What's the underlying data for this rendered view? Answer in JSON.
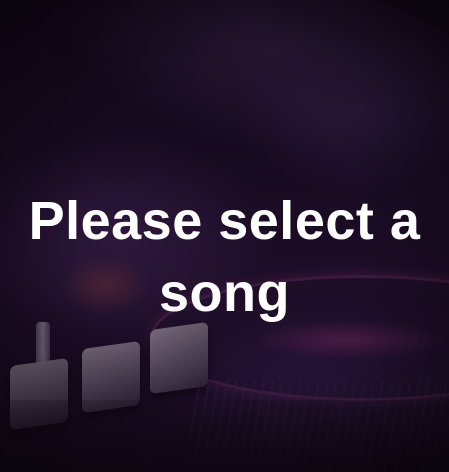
{
  "screen": {
    "message": "Please select a song",
    "background_image": "dj-mixer-photo",
    "colors": {
      "text": "#ffffff",
      "background_tint": "#1a0d24",
      "accent_glow": "#b43c82"
    }
  }
}
